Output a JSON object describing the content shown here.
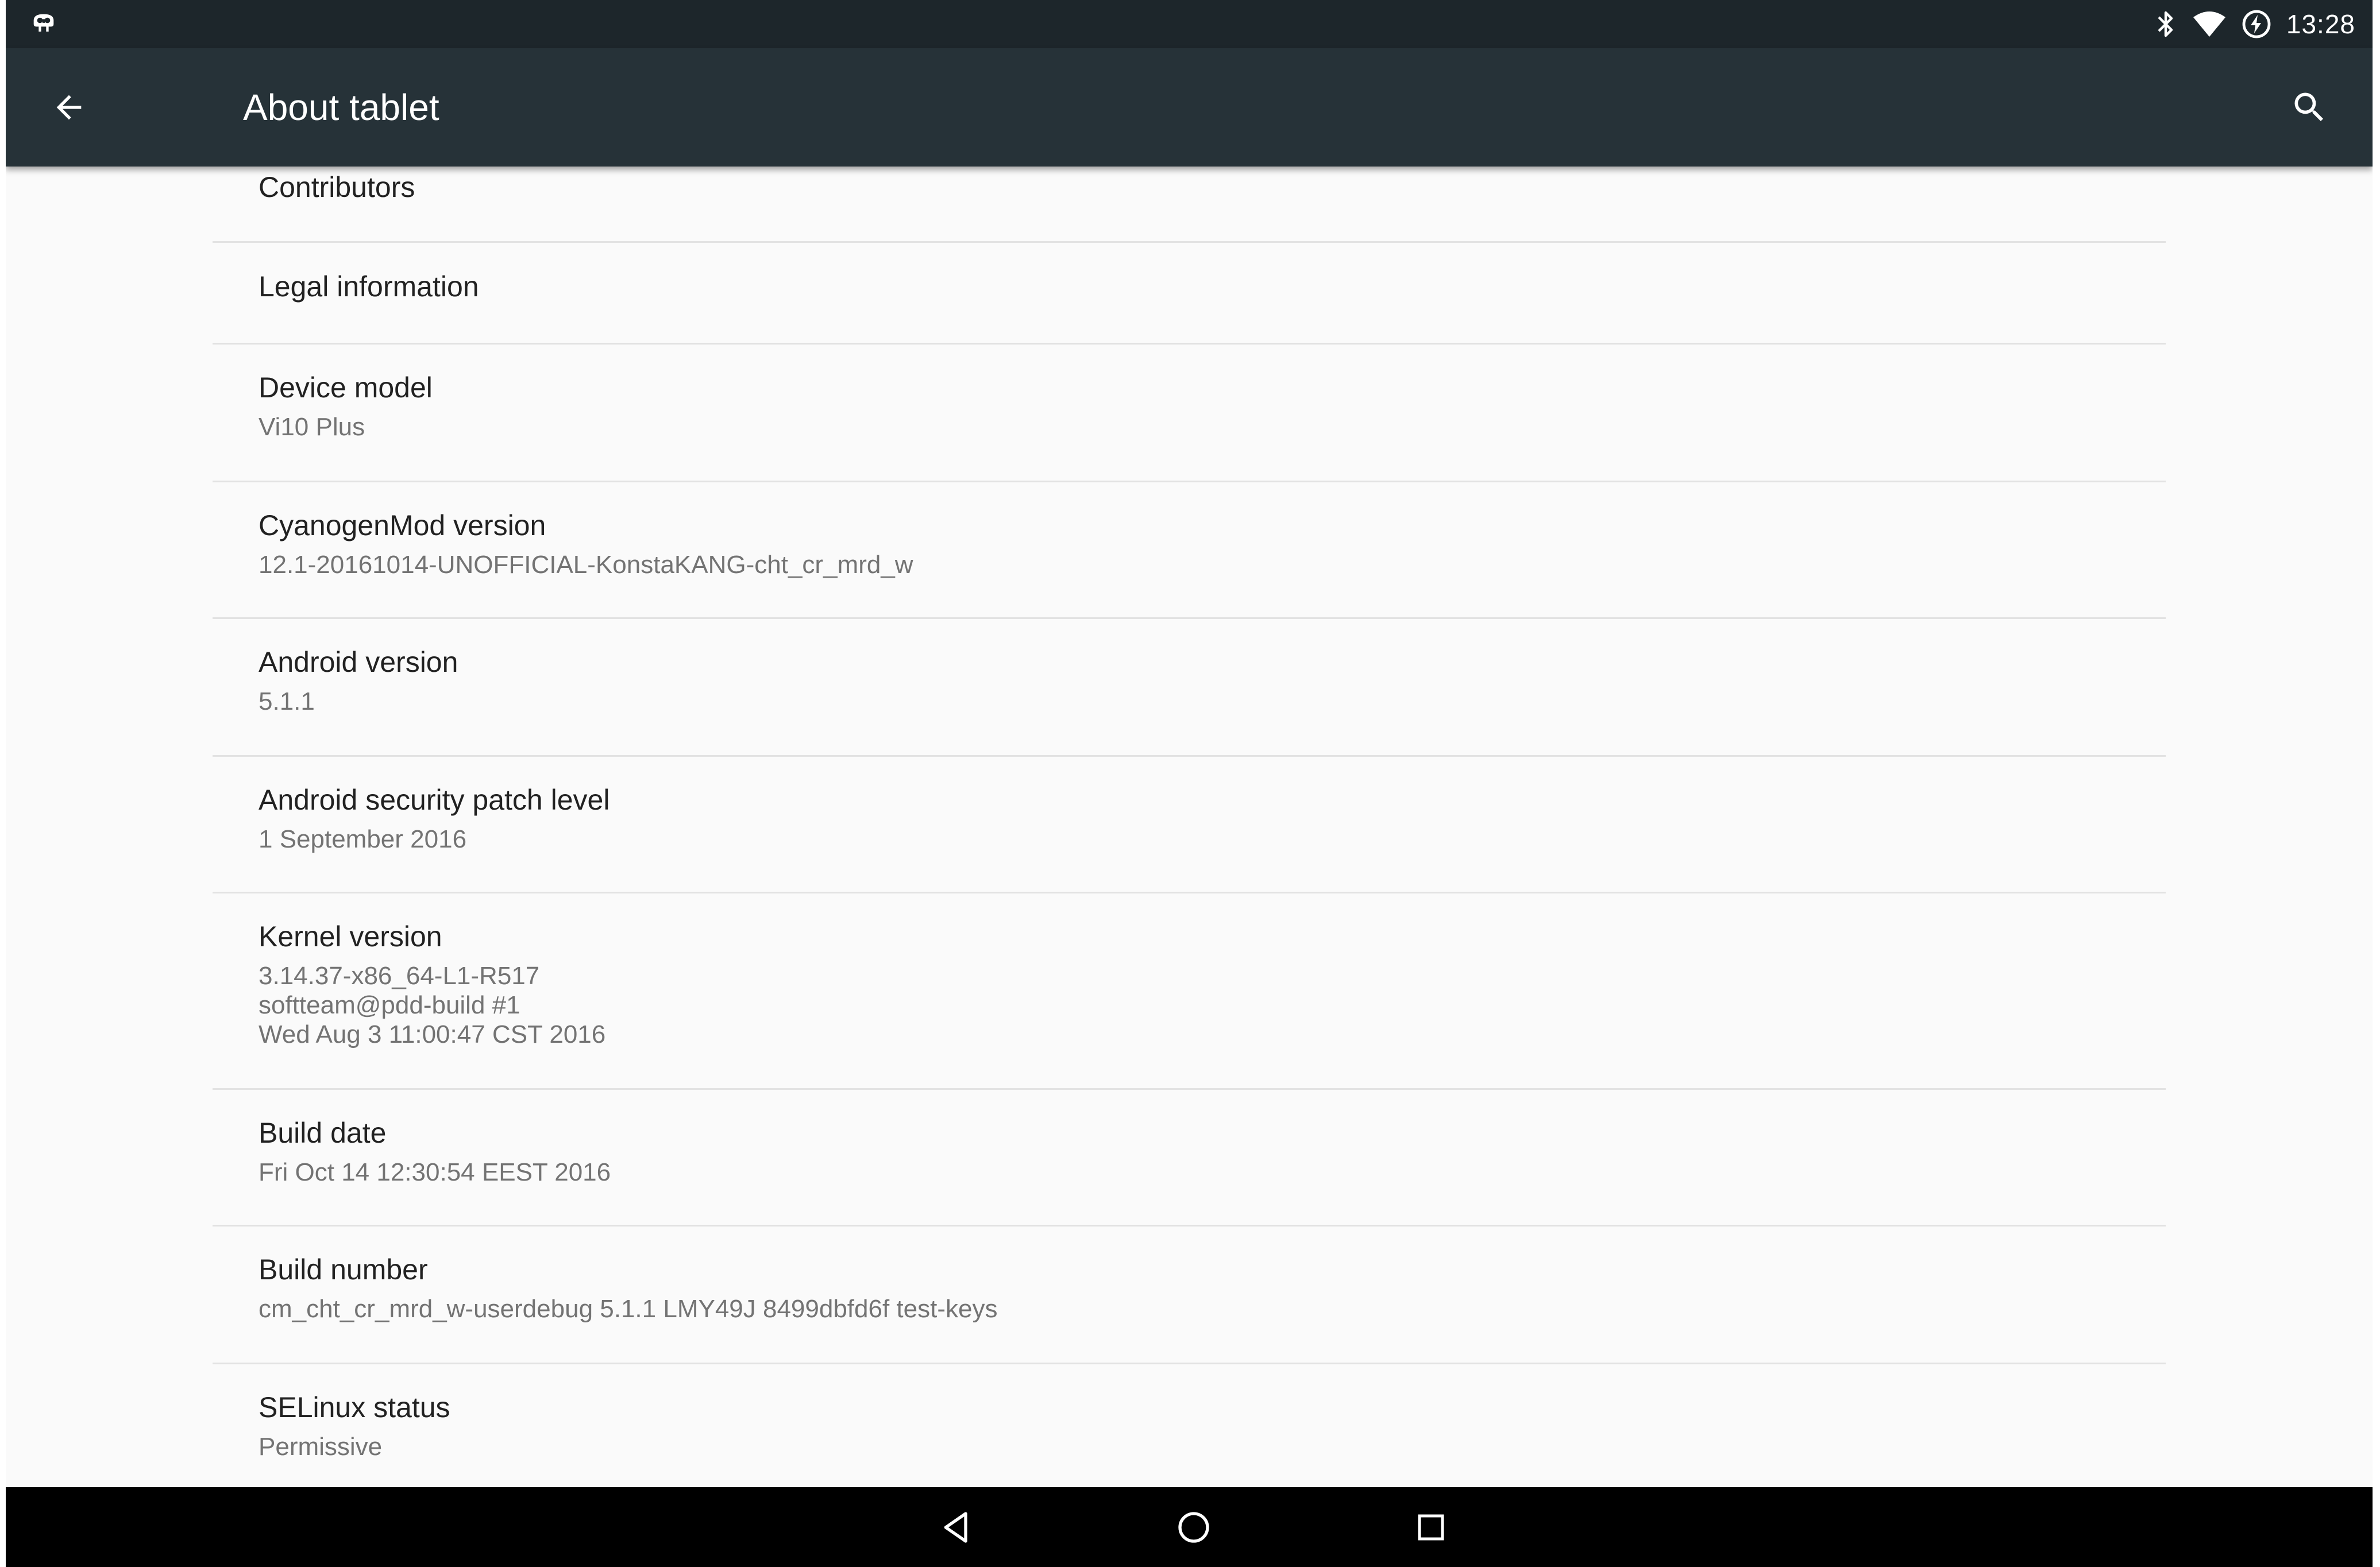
{
  "status_bar": {
    "time": "13:28",
    "icons": [
      "cyanogenmod-icon",
      "bluetooth-icon",
      "wifi-icon",
      "battery-charging-icon"
    ]
  },
  "app_bar": {
    "title": "About tablet",
    "back_icon": "arrow-back-icon",
    "search_icon": "search-icon"
  },
  "items": [
    {
      "title": "Contributors",
      "summary": ""
    },
    {
      "title": "Legal information",
      "summary": ""
    },
    {
      "title": "Device model",
      "summary": "Vi10 Plus"
    },
    {
      "title": "CyanogenMod version",
      "summary": "12.1-20161014-UNOFFICIAL-KonstaKANG-cht_cr_mrd_w"
    },
    {
      "title": "Android version",
      "summary": "5.1.1"
    },
    {
      "title": "Android security patch level",
      "summary": "1 September 2016"
    },
    {
      "title": "Kernel version",
      "summary": "3.14.37-x86_64-L1-R517\nsoftteam@pdd-build #1\nWed Aug 3 11:00:47 CST 2016"
    },
    {
      "title": "Build date",
      "summary": "Fri Oct 14 12:30:54 EEST 2016"
    },
    {
      "title": "Build number",
      "summary": "cm_cht_cr_mrd_w-userdebug 5.1.1 LMY49J 8499dbfd6f test-keys"
    },
    {
      "title": "SELinux status",
      "summary": "Permissive"
    }
  ],
  "nav_bar": {
    "icons": [
      "back-triangle-icon",
      "home-circle-icon",
      "recents-square-icon"
    ]
  },
  "colors": {
    "status_bar": "#1d262b",
    "app_bar": "#263238",
    "background": "#fafafa",
    "divider": "#e2e2e2",
    "title_text": "#212121",
    "summary_text": "#737373"
  }
}
